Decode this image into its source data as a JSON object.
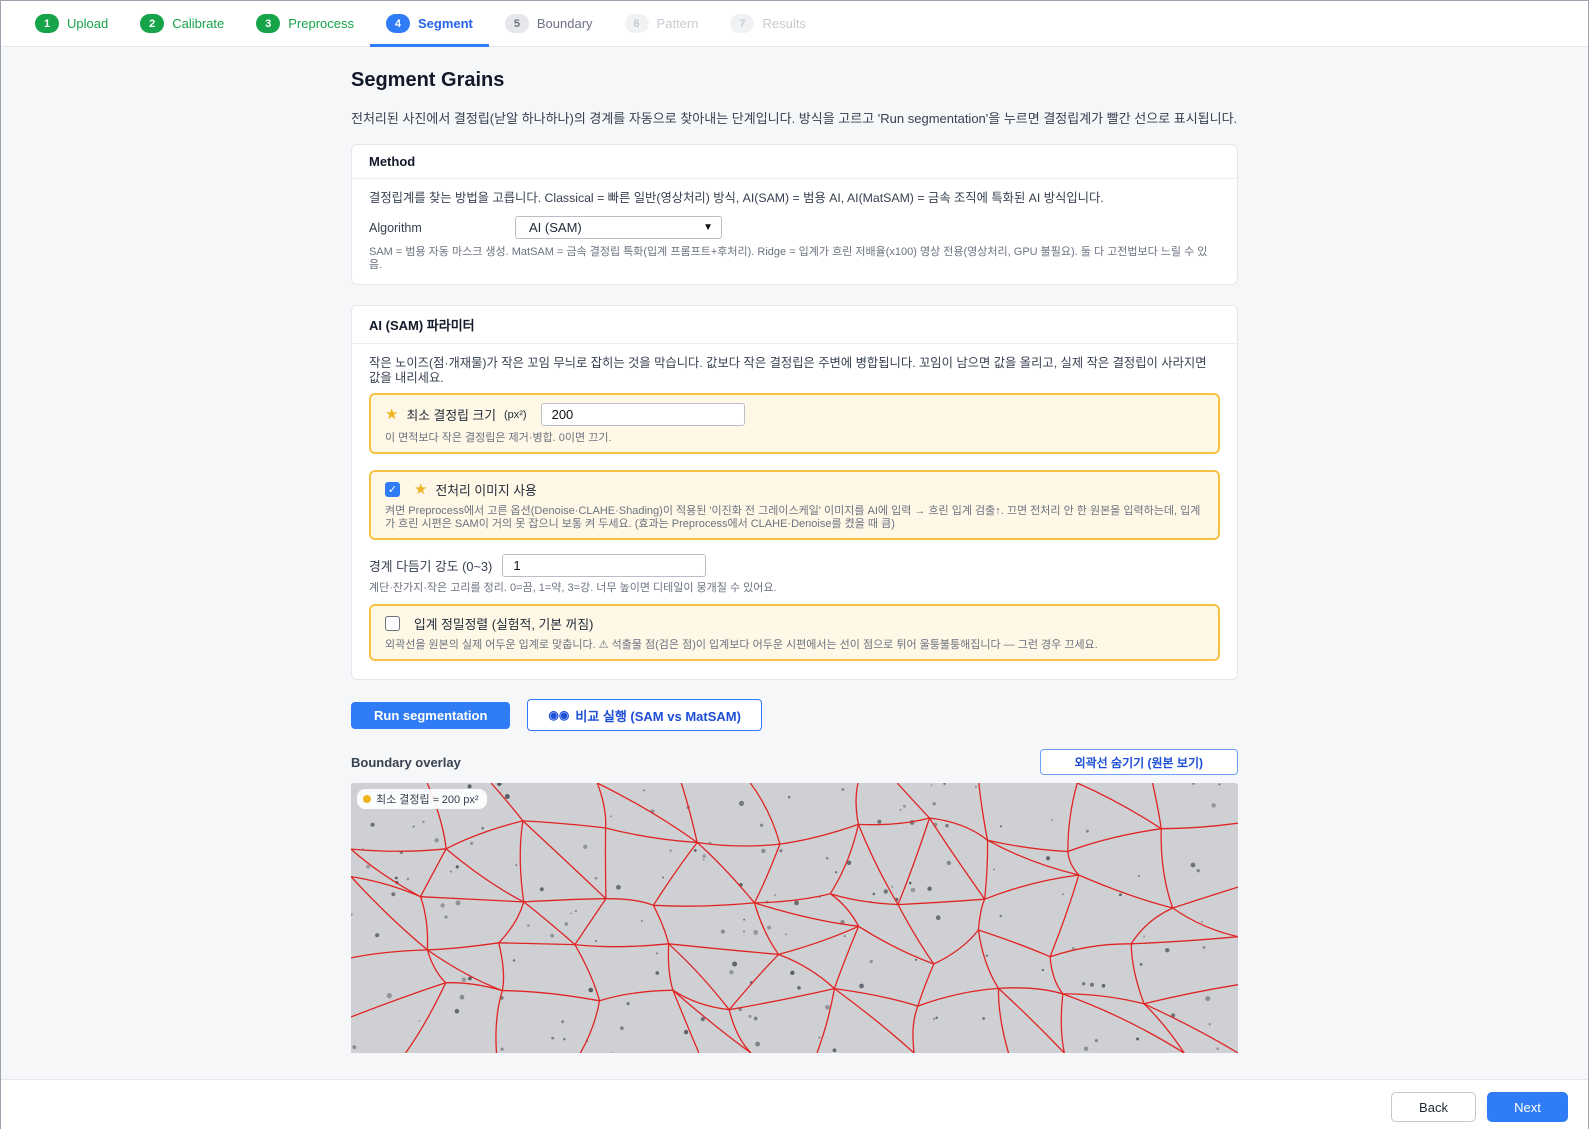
{
  "steps": [
    {
      "num": "1",
      "label": "Upload"
    },
    {
      "num": "2",
      "label": "Calibrate"
    },
    {
      "num": "3",
      "label": "Preprocess"
    },
    {
      "num": "4",
      "label": "Segment"
    },
    {
      "num": "5",
      "label": "Boundary"
    },
    {
      "num": "6",
      "label": "Pattern"
    },
    {
      "num": "7",
      "label": "Results"
    }
  ],
  "page": {
    "title": "Segment Grains",
    "intro": "전처리된 사진에서 결정립(낟알 하나하나)의 경계를 자동으로 찾아내는 단계입니다. 방식을 고르고 'Run segmentation'을 누르면 결정립계가 빨간 선으로 표시됩니다."
  },
  "method": {
    "heading": "Method",
    "description": "결정립계를 찾는 방법을 고릅니다. Classical = 빠른 일반(영상처리) 방식, AI(SAM) = 범용 AI, AI(MatSAM) = 금속 조직에 특화된 AI 방식입니다.",
    "algorithm_label": "Algorithm",
    "algorithm_value": "AI (SAM)",
    "hint": "SAM = 범용 자동 마스크 생성. MatSAM = 금속 결정립 특화(입계 프롬프트+후처리). Ridge = 입계가 흐린 저배율(x100) 영상 전용(영상처리, GPU 불필요). 둘 다 고전법보다 느릴 수 있음."
  },
  "params": {
    "heading": "AI (SAM) 파라미터",
    "description": "작은 노이즈(점·개재물)가 작은 꼬임 무늬로 잡히는 것을 막습니다. 값보다 작은 결정립은 주변에 병합됩니다. 꼬임이 남으면 값을 올리고, 실제 작은 결정립이 사라지면 값을 내리세요.",
    "min_grain": {
      "label": "최소 결정립 크기",
      "unit": "(px²)",
      "value": "200",
      "hint": "이 면적보다 작은 결정립은 제거·병합. 0이면 끄기."
    },
    "use_preprocessed": {
      "checked": true,
      "label": "전처리 이미지 사용",
      "hint": "켜면 Preprocess에서 고른 옵션(Denoise·CLAHE·Shading)이 적용된 '이진화 전 그레이스케일' 이미지를 AI에 입력 → 흐린 입계 검출↑. 끄면 전처리 안 한 원본을 입력하는데, 입계가 흐린 시편은 SAM이 거의 못 잡으니 보통 켜 두세요. (효과는 Preprocess에서 CLAHE·Denoise를 켰을 때 큼)"
    },
    "smoothing": {
      "label": "경계 다듬기 강도 (0~3)",
      "value": "1",
      "hint": "계단·잔가지·작은 고리를 정리. 0=끔, 1=약, 3=강. 너무 높이면 디테일이 뭉개질 수 있어요."
    },
    "refine": {
      "checked": false,
      "label": "입계 정밀정렬 (실험적, 기본 꺼짐)",
      "hint": "외곽선을 원본의 실제 어두운 입계로 맞춥니다. ⚠ 석출물 점(검은 점)이 입계보다 어두운 시편에서는 선이 점으로 튀어 울퉁불퉁해집니다 — 그런 경우 끄세요."
    }
  },
  "actions": {
    "run": "Run segmentation",
    "compare": "비교 실행 (SAM vs MatSAM)",
    "compare_icon": "binoculars-icon"
  },
  "overlay": {
    "title": "Boundary overlay",
    "toggle": "외곽선 숨기기 (원본 보기)",
    "badge": "최소 결정립 ≈ 200 px²",
    "boundary_color": "#e02424"
  },
  "footer": {
    "back": "Back",
    "next": "Next"
  },
  "colors": {
    "accent": "#2f7cf6",
    "done": "#16a34a",
    "highlight_bg": "#fff8e6",
    "highlight_border": "#f5c242"
  }
}
